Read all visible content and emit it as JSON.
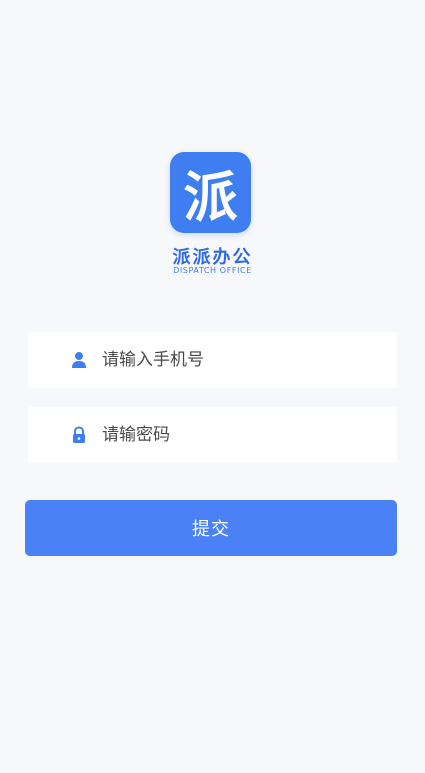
{
  "brand": {
    "logo_char": "派",
    "name": "派派办公",
    "subtitle": "DISPATCH OFFICE",
    "color": "#3f7ef0"
  },
  "form": {
    "phone": {
      "icon": "user-icon",
      "placeholder": "请输入手机号",
      "value": ""
    },
    "password": {
      "icon": "lock-icon",
      "placeholder": "请输密码",
      "value": ""
    },
    "submit_label": "提交",
    "submit_color": "#4a82f5"
  }
}
